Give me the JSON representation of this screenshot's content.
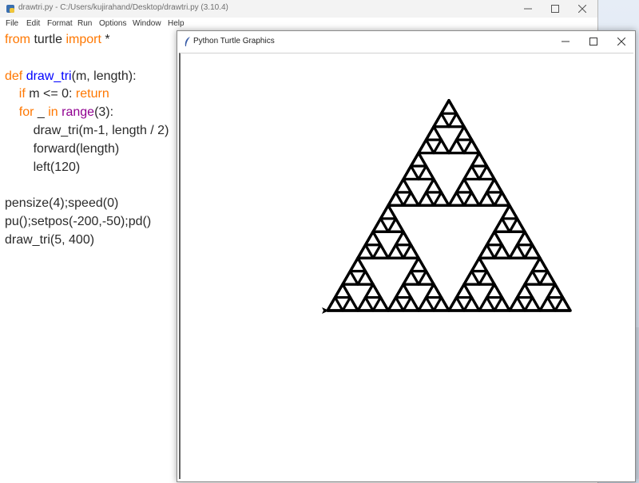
{
  "idle_window": {
    "title": "drawtri.py - C:/Users/kujirahand/Desktop/drawtri.py (3.10.4)",
    "menu": [
      "File",
      "Edit",
      "Format",
      "Run",
      "Options",
      "Window",
      "Help"
    ],
    "code_lines": [
      [
        {
          "t": "from",
          "c": "kw"
        },
        {
          "t": " turtle ",
          "c": ""
        },
        {
          "t": "import",
          "c": "kw"
        },
        {
          "t": " *",
          "c": ""
        }
      ],
      [],
      [
        {
          "t": "def",
          "c": "kw"
        },
        {
          "t": " ",
          "c": ""
        },
        {
          "t": "draw_tri",
          "c": "def"
        },
        {
          "t": "(m, length):",
          "c": ""
        }
      ],
      [
        {
          "t": "    ",
          "c": ""
        },
        {
          "t": "if",
          "c": "kw"
        },
        {
          "t": " m <= 0: ",
          "c": ""
        },
        {
          "t": "return",
          "c": "kw"
        }
      ],
      [
        {
          "t": "    ",
          "c": ""
        },
        {
          "t": "for",
          "c": "kw"
        },
        {
          "t": " _ ",
          "c": ""
        },
        {
          "t": "in",
          "c": "kw"
        },
        {
          "t": " ",
          "c": ""
        },
        {
          "t": "range",
          "c": "bi"
        },
        {
          "t": "(3):",
          "c": ""
        }
      ],
      [
        {
          "t": "        draw_tri(m-1, length / 2)",
          "c": ""
        }
      ],
      [
        {
          "t": "        forward(length)",
          "c": ""
        }
      ],
      [
        {
          "t": "        left(120)",
          "c": ""
        }
      ],
      [],
      [
        {
          "t": "pensize(4);speed(0)",
          "c": ""
        }
      ],
      [
        {
          "t": "pu();setpos(-200,-50);pd()",
          "c": ""
        }
      ],
      [
        {
          "t": "draw_tri(5, 400)",
          "c": ""
        }
      ]
    ]
  },
  "turtle_window": {
    "title": "Python Turtle Graphics",
    "drawing": {
      "depth": 5,
      "length": 400,
      "start": [
        -200,
        -50
      ],
      "pensize": 4,
      "pen_color": "#000000"
    }
  },
  "icons": {
    "minimize": "minimize-icon",
    "maximize": "maximize-icon",
    "close": "close-icon"
  },
  "colors": {
    "keyword": "#ff7700",
    "builtin": "#900090",
    "definition": "#0000ff",
    "text": "#2a2a2a"
  }
}
